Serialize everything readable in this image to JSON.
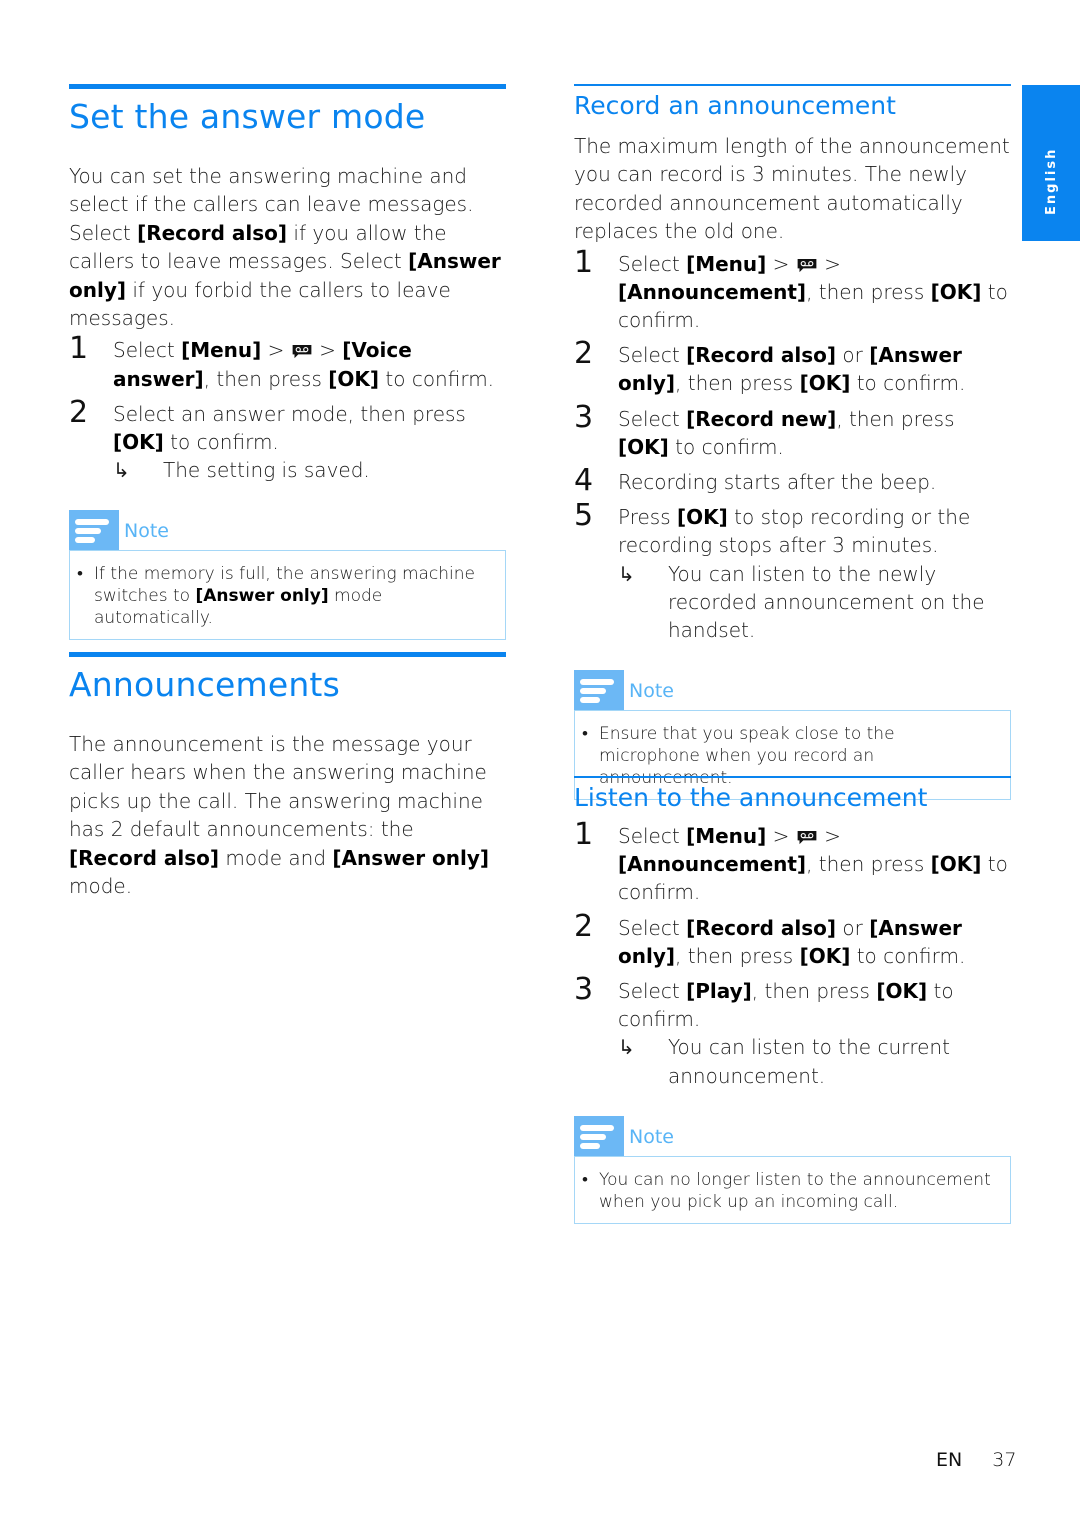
{
  "language_tab": "English",
  "left": {
    "answer_mode": {
      "title": "Set the answer mode",
      "intro": [
        {
          "t": "You can set the answering machine and select if the callers can leave messages. Select "
        },
        {
          "b": "[Record also]"
        },
        {
          "t": " if you allow the callers to leave messages. Select "
        },
        {
          "b": "[Answer only]"
        },
        {
          "t": " if you forbid the callers to leave messages."
        }
      ],
      "steps": [
        {
          "num": "1",
          "parts": [
            {
              "t": "Select "
            },
            {
              "b": "[Menu]"
            },
            {
              "t": " > "
            },
            {
              "icon": "cassette"
            },
            {
              "t": " > "
            },
            {
              "b": "[Voice answer]"
            },
            {
              "t": ", then press "
            },
            {
              "b": "[OK]"
            },
            {
              "t": " to confirm."
            }
          ]
        },
        {
          "num": "2",
          "parts": [
            {
              "t": "Select an answer mode, then press "
            },
            {
              "b": "[OK]"
            },
            {
              "t": " to confirm."
            }
          ],
          "result": "The setting is saved."
        }
      ],
      "note": {
        "label": "Note",
        "bullet": [
          {
            "t": "If the memory is full, the answering machine switches to "
          },
          {
            "b": "[Answer only]"
          },
          {
            "t": " mode automatically."
          }
        ]
      }
    },
    "announcements": {
      "title": "Announcements",
      "intro": [
        {
          "t": "The announcement is the message your caller hears when the answering machine picks up the call. The answering machine has 2 default announcements: the "
        },
        {
          "b": "[Record also]"
        },
        {
          "t": " mode and "
        },
        {
          "b": "[Answer only]"
        },
        {
          "t": " mode."
        }
      ]
    }
  },
  "right": {
    "record": {
      "title": "Record an announcement",
      "intro": "The maximum length of the announcement you can record is 3 minutes. The newly recorded announcement automatically replaces the old one.",
      "steps": [
        {
          "num": "1",
          "parts": [
            {
              "t": "Select "
            },
            {
              "b": "[Menu]"
            },
            {
              "t": " > "
            },
            {
              "icon": "cassette"
            },
            {
              "t": " > "
            },
            {
              "b": "[Announcement]"
            },
            {
              "t": ", then press "
            },
            {
              "b": "[OK]"
            },
            {
              "t": " to confirm."
            }
          ]
        },
        {
          "num": "2",
          "parts": [
            {
              "t": "Select "
            },
            {
              "b": "[Record also]"
            },
            {
              "t": " or "
            },
            {
              "b": "[Answer only]"
            },
            {
              "t": ", then press "
            },
            {
              "b": "[OK]"
            },
            {
              "t": " to confirm."
            }
          ]
        },
        {
          "num": "3",
          "parts": [
            {
              "t": "Select "
            },
            {
              "b": "[Record new]"
            },
            {
              "t": ", then press "
            },
            {
              "b": "[OK]"
            },
            {
              "t": " to confirm."
            }
          ]
        },
        {
          "num": "4",
          "parts": [
            {
              "t": "Recording starts after the beep."
            }
          ]
        },
        {
          "num": "5",
          "parts": [
            {
              "t": "Press "
            },
            {
              "b": "[OK]"
            },
            {
              "t": " to stop recording or the recording stops after 3 minutes."
            }
          ],
          "result": "You can listen to the newly recorded announcement on the handset."
        }
      ],
      "note": {
        "label": "Note",
        "bullet": [
          {
            "t": "Ensure that you speak close to the microphone when you record an announcement."
          }
        ]
      }
    },
    "listen": {
      "title": "Listen to the announcement",
      "steps": [
        {
          "num": "1",
          "parts": [
            {
              "t": "Select "
            },
            {
              "b": "[Menu]"
            },
            {
              "t": " > "
            },
            {
              "icon": "cassette"
            },
            {
              "t": " > "
            },
            {
              "b": "[Announcement]"
            },
            {
              "t": ", then press "
            },
            {
              "b": "[OK]"
            },
            {
              "t": " to confirm."
            }
          ]
        },
        {
          "num": "2",
          "parts": [
            {
              "t": "Select "
            },
            {
              "b": "[Record also]"
            },
            {
              "t": " or "
            },
            {
              "b": "[Answer only]"
            },
            {
              "t": ", then press "
            },
            {
              "b": "[OK]"
            },
            {
              "t": " to confirm."
            }
          ]
        },
        {
          "num": "3",
          "parts": [
            {
              "t": "Select "
            },
            {
              "b": "[Play]"
            },
            {
              "t": ", then press "
            },
            {
              "b": "[OK]"
            },
            {
              "t": " to confirm."
            }
          ],
          "result": "You can listen to the current announcement."
        }
      ],
      "note": {
        "label": "Note",
        "bullet": [
          {
            "t": "You can no longer listen to the announcement when you pick up an incoming call."
          }
        ]
      }
    }
  },
  "footer": {
    "lang": "EN",
    "page": "37"
  },
  "symbols": {
    "arrow": "↳",
    "bullet": "•"
  }
}
